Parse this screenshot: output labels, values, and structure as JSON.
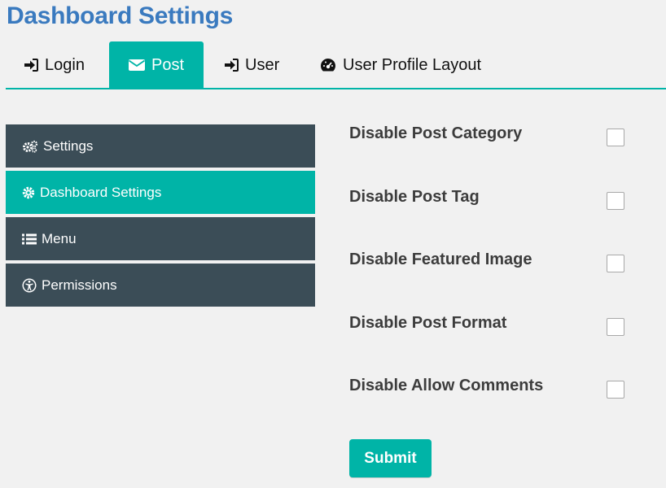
{
  "page": {
    "title": "Dashboard Settings"
  },
  "tabs": [
    {
      "label": "Login",
      "icon": "sign-in-icon",
      "active": false
    },
    {
      "label": "Post",
      "icon": "envelope-icon",
      "active": true
    },
    {
      "label": "User",
      "icon": "sign-in-icon",
      "active": false
    },
    {
      "label": "User Profile Layout",
      "icon": "dashboard-icon",
      "active": false
    }
  ],
  "sidebar": {
    "items": [
      {
        "label": "Settings",
        "icon": "gears-icon",
        "active": false
      },
      {
        "label": "Dashboard Settings",
        "icon": "gear-icon",
        "active": true
      },
      {
        "label": "Menu",
        "icon": "list-icon",
        "active": false
      },
      {
        "label": "Permissions",
        "icon": "universal-access-icon",
        "active": false
      }
    ]
  },
  "options": [
    {
      "label": "Disable Post Category",
      "checked": false
    },
    {
      "label": "Disable Post Tag",
      "checked": false
    },
    {
      "label": "Disable Featured Image",
      "checked": false
    },
    {
      "label": "Disable Post Format",
      "checked": false
    },
    {
      "label": "Disable Allow Comments",
      "checked": false
    }
  ],
  "submit": {
    "label": "Submit"
  },
  "colors": {
    "accent": "#00b4a7",
    "sidebar_bg": "#3b4d57",
    "title": "#3a7abf"
  }
}
